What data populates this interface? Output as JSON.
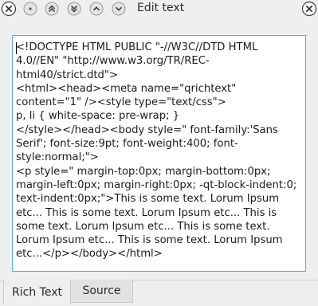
{
  "window": {
    "title": "Edit text"
  },
  "titlebar": {
    "close_icon": "close-icon",
    "menu_icon": "window-menu-icon",
    "keep_above_icon": "keep-above-icon",
    "keep_below_icon": "keep-below-icon",
    "minimize_icon": "minimize-icon",
    "maximize_icon": "maximize-icon",
    "close_right_icon": "close-icon"
  },
  "editor": {
    "content": "<!DOCTYPE HTML PUBLIC \"-//W3C//DTD HTML 4.0//EN\" \"http://www.w3.org/TR/REC-html40/strict.dtd\">\n<html><head><meta name=\"qrichtext\" content=\"1\" /><style type=\"text/css\">\np, li { white-space: pre-wrap; }\n</style></head><body style=\" font-family:'Sans Serif'; font-size:9pt; font-weight:400; font-style:normal;\">\n<p style=\" margin-top:0px; margin-bottom:0px; margin-left:0px; margin-right:0px; -qt-block-indent:0; text-indent:0px;\">This is some text. Lorum Ipsum etc... This is some text. Lorum Ipsum etc... This is some text. Lorum Ipsum etc... This is some text. Lorum Ipsum etc... This is some text. Lorum Ipsum etc...</p></body></html>"
  },
  "tabs": [
    {
      "label": "Rich Text",
      "active": true
    },
    {
      "label": "Source",
      "active": false
    }
  ],
  "colors": {
    "focus_border": "#63aad6",
    "background": "#efefef"
  }
}
